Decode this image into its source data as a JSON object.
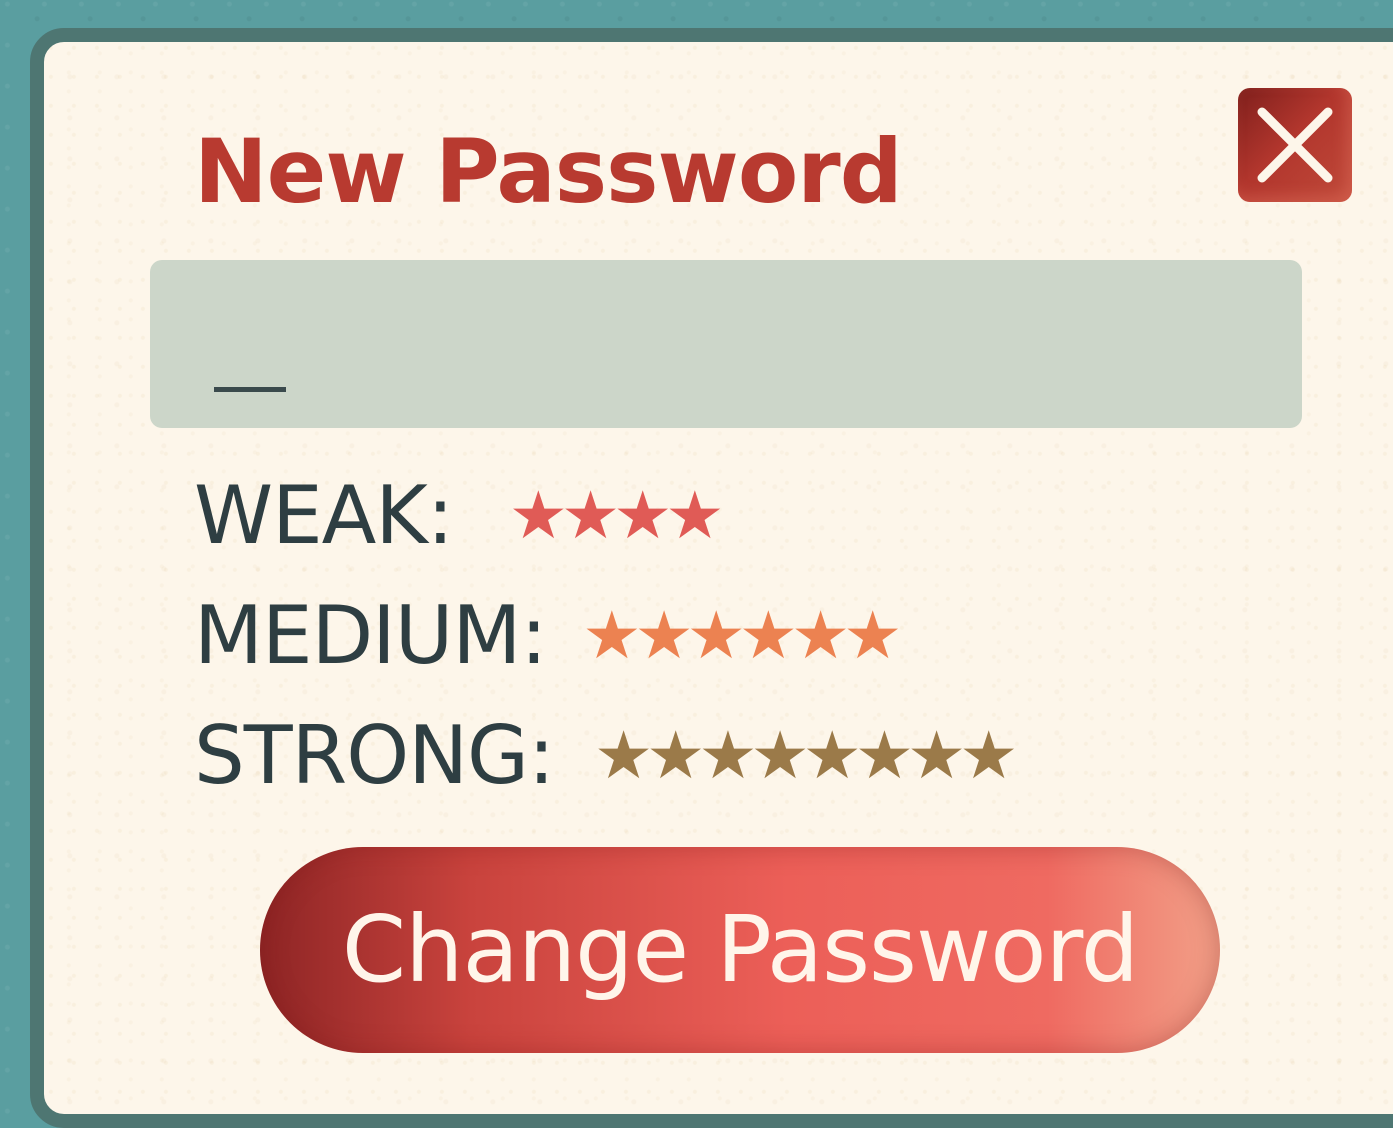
{
  "dialog": {
    "title": "New Password",
    "close_icon": "close-x-icon"
  },
  "password_field": {
    "value": "",
    "caret": "_"
  },
  "strength_legend": [
    {
      "label": "WEAK:",
      "stars": "★★★★",
      "star_count": 4,
      "color": "#e05b56"
    },
    {
      "label": "MEDIUM:",
      "stars": "★★★★★★",
      "star_count": 6,
      "color": "#ec8251"
    },
    {
      "label": "STRONG:",
      "stars": "★★★★★★★★",
      "star_count": 8,
      "color": "#9b7a49"
    }
  ],
  "actions": {
    "change_password_label": "Change Password"
  },
  "colors": {
    "background": "#5a9ea0",
    "panel": "#fdf6ea",
    "panel_border": "#4e7672",
    "title": "#b83a30",
    "field": "#ccd6c9",
    "button": "#ec5f58"
  }
}
